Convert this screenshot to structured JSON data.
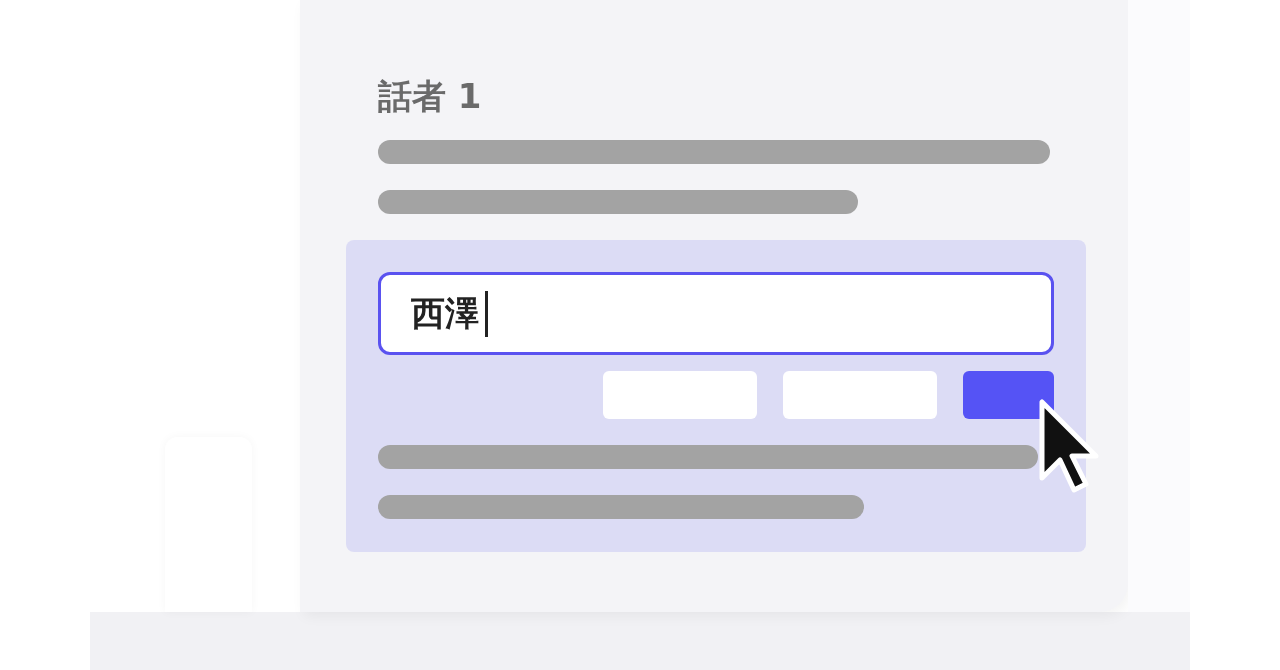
{
  "speaker": {
    "title": "話者 1"
  },
  "lines_before": [
    {
      "kind": "long"
    },
    {
      "kind": "short"
    }
  ],
  "editor": {
    "value": "西澤",
    "focused": true,
    "buttons": [
      {
        "kind": "secondary"
      },
      {
        "kind": "secondary"
      },
      {
        "kind": "primary"
      }
    ],
    "lines_after": [
      {
        "kind": "long"
      },
      {
        "kind": "short"
      }
    ]
  }
}
